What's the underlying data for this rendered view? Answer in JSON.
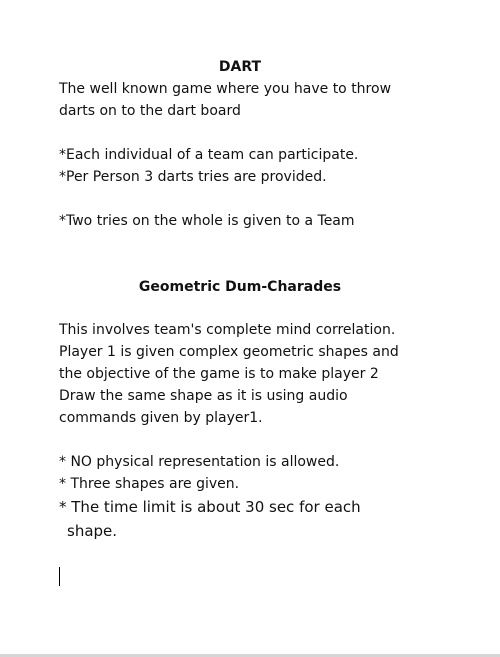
{
  "document": {
    "sections": [
      {
        "title": "DART",
        "intro": [
          "The well known game where you have to throw",
          "darts on to the dart board"
        ],
        "rules": [
          "*Each individual of a team can participate.",
          "*Per Person 3 darts tries are provided."
        ],
        "note": "*Two tries on the whole is given to a Team"
      },
      {
        "title": "Geometric Dum-Charades",
        "intro": [
          "This involves team's complete mind correlation.",
          "Player 1 is given complex geometric shapes and",
          "the objective of the game is to make player 2",
          "Draw the same shape as it is using audio",
          "commands given by player1."
        ],
        "rules": [
          "* NO physical representation is allowed.",
          "* Three shapes are given.",
          "* The time limit is about 30 sec for each",
          "shape."
        ]
      }
    ]
  }
}
